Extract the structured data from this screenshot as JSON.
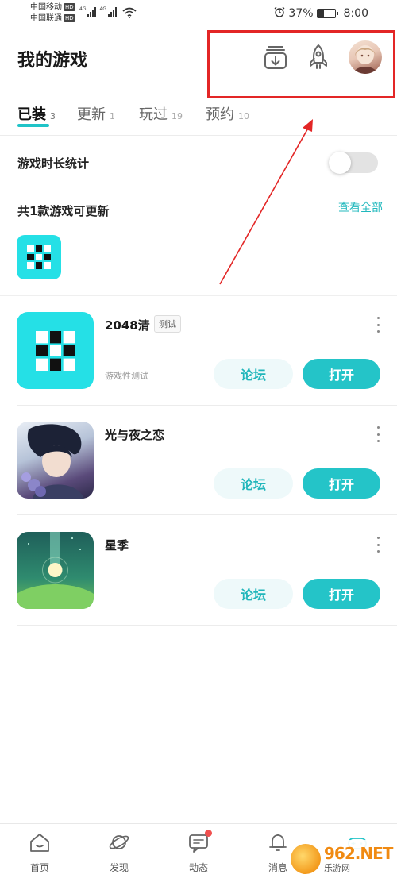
{
  "status_bar": {
    "carrier1": "中国移动",
    "carrier2": "中国联通",
    "hd": "HD",
    "network": "4G",
    "battery": "37%",
    "battery_level": 0.37,
    "time": "8:00"
  },
  "header": {
    "title": "我的游戏"
  },
  "tabs": [
    {
      "label": "已装",
      "count": "3"
    },
    {
      "label": "更新",
      "count": "1"
    },
    {
      "label": "玩过",
      "count": "19"
    },
    {
      "label": "预约",
      "count": "10"
    }
  ],
  "playtime": {
    "label": "游戏时长统计",
    "enabled": false
  },
  "updates": {
    "label": "共1款游戏可更新",
    "view_all": "查看全部"
  },
  "games": [
    {
      "name": "2048清",
      "tag": "测试",
      "desc": "游戏性测试",
      "forum": "论坛",
      "open": "打开"
    },
    {
      "name": "光与夜之恋",
      "tag": "",
      "desc": "",
      "forum": "论坛",
      "open": "打开"
    },
    {
      "name": "星季",
      "tag": "",
      "desc": "",
      "forum": "论坛",
      "open": "打开"
    }
  ],
  "bottom_nav": [
    {
      "label": "首页",
      "icon": "home-icon"
    },
    {
      "label": "发现",
      "icon": "planet-icon"
    },
    {
      "label": "动态",
      "icon": "chat-icon"
    },
    {
      "label": "消息",
      "icon": "bell-icon"
    },
    {
      "label": "",
      "icon": "game-controller-icon"
    }
  ],
  "watermark": {
    "brand": "962.NET",
    "subtitle": "乐游网"
  },
  "colors": {
    "accent": "#24c4c8",
    "highlight": "#e32626",
    "badge": "#f0504f"
  }
}
